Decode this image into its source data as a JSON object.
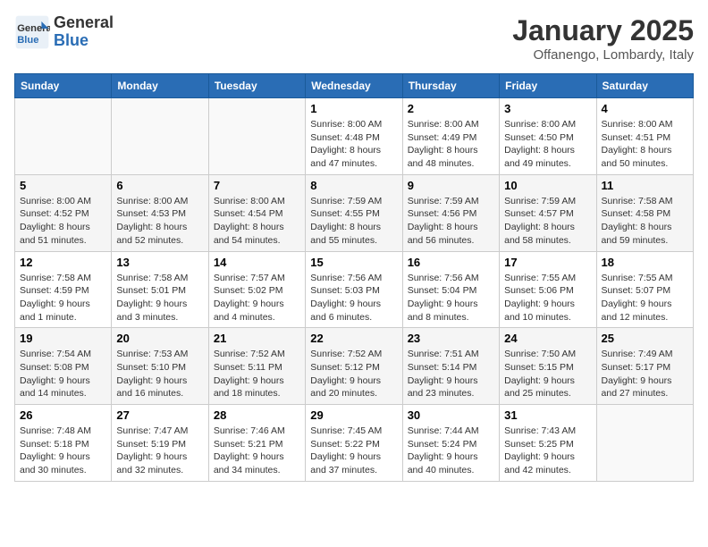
{
  "logo": {
    "line1": "General",
    "line2": "Blue"
  },
  "title": "January 2025",
  "location": "Offanengo, Lombardy, Italy",
  "weekdays": [
    "Sunday",
    "Monday",
    "Tuesday",
    "Wednesday",
    "Thursday",
    "Friday",
    "Saturday"
  ],
  "weeks": [
    [
      {
        "day": "",
        "info": ""
      },
      {
        "day": "",
        "info": ""
      },
      {
        "day": "",
        "info": ""
      },
      {
        "day": "1",
        "info": "Sunrise: 8:00 AM\nSunset: 4:48 PM\nDaylight: 8 hours and 47 minutes."
      },
      {
        "day": "2",
        "info": "Sunrise: 8:00 AM\nSunset: 4:49 PM\nDaylight: 8 hours and 48 minutes."
      },
      {
        "day": "3",
        "info": "Sunrise: 8:00 AM\nSunset: 4:50 PM\nDaylight: 8 hours and 49 minutes."
      },
      {
        "day": "4",
        "info": "Sunrise: 8:00 AM\nSunset: 4:51 PM\nDaylight: 8 hours and 50 minutes."
      }
    ],
    [
      {
        "day": "5",
        "info": "Sunrise: 8:00 AM\nSunset: 4:52 PM\nDaylight: 8 hours and 51 minutes."
      },
      {
        "day": "6",
        "info": "Sunrise: 8:00 AM\nSunset: 4:53 PM\nDaylight: 8 hours and 52 minutes."
      },
      {
        "day": "7",
        "info": "Sunrise: 8:00 AM\nSunset: 4:54 PM\nDaylight: 8 hours and 54 minutes."
      },
      {
        "day": "8",
        "info": "Sunrise: 7:59 AM\nSunset: 4:55 PM\nDaylight: 8 hours and 55 minutes."
      },
      {
        "day": "9",
        "info": "Sunrise: 7:59 AM\nSunset: 4:56 PM\nDaylight: 8 hours and 56 minutes."
      },
      {
        "day": "10",
        "info": "Sunrise: 7:59 AM\nSunset: 4:57 PM\nDaylight: 8 hours and 58 minutes."
      },
      {
        "day": "11",
        "info": "Sunrise: 7:58 AM\nSunset: 4:58 PM\nDaylight: 8 hours and 59 minutes."
      }
    ],
    [
      {
        "day": "12",
        "info": "Sunrise: 7:58 AM\nSunset: 4:59 PM\nDaylight: 9 hours and 1 minute."
      },
      {
        "day": "13",
        "info": "Sunrise: 7:58 AM\nSunset: 5:01 PM\nDaylight: 9 hours and 3 minutes."
      },
      {
        "day": "14",
        "info": "Sunrise: 7:57 AM\nSunset: 5:02 PM\nDaylight: 9 hours and 4 minutes."
      },
      {
        "day": "15",
        "info": "Sunrise: 7:56 AM\nSunset: 5:03 PM\nDaylight: 9 hours and 6 minutes."
      },
      {
        "day": "16",
        "info": "Sunrise: 7:56 AM\nSunset: 5:04 PM\nDaylight: 9 hours and 8 minutes."
      },
      {
        "day": "17",
        "info": "Sunrise: 7:55 AM\nSunset: 5:06 PM\nDaylight: 9 hours and 10 minutes."
      },
      {
        "day": "18",
        "info": "Sunrise: 7:55 AM\nSunset: 5:07 PM\nDaylight: 9 hours and 12 minutes."
      }
    ],
    [
      {
        "day": "19",
        "info": "Sunrise: 7:54 AM\nSunset: 5:08 PM\nDaylight: 9 hours and 14 minutes."
      },
      {
        "day": "20",
        "info": "Sunrise: 7:53 AM\nSunset: 5:10 PM\nDaylight: 9 hours and 16 minutes."
      },
      {
        "day": "21",
        "info": "Sunrise: 7:52 AM\nSunset: 5:11 PM\nDaylight: 9 hours and 18 minutes."
      },
      {
        "day": "22",
        "info": "Sunrise: 7:52 AM\nSunset: 5:12 PM\nDaylight: 9 hours and 20 minutes."
      },
      {
        "day": "23",
        "info": "Sunrise: 7:51 AM\nSunset: 5:14 PM\nDaylight: 9 hours and 23 minutes."
      },
      {
        "day": "24",
        "info": "Sunrise: 7:50 AM\nSunset: 5:15 PM\nDaylight: 9 hours and 25 minutes."
      },
      {
        "day": "25",
        "info": "Sunrise: 7:49 AM\nSunset: 5:17 PM\nDaylight: 9 hours and 27 minutes."
      }
    ],
    [
      {
        "day": "26",
        "info": "Sunrise: 7:48 AM\nSunset: 5:18 PM\nDaylight: 9 hours and 30 minutes."
      },
      {
        "day": "27",
        "info": "Sunrise: 7:47 AM\nSunset: 5:19 PM\nDaylight: 9 hours and 32 minutes."
      },
      {
        "day": "28",
        "info": "Sunrise: 7:46 AM\nSunset: 5:21 PM\nDaylight: 9 hours and 34 minutes."
      },
      {
        "day": "29",
        "info": "Sunrise: 7:45 AM\nSunset: 5:22 PM\nDaylight: 9 hours and 37 minutes."
      },
      {
        "day": "30",
        "info": "Sunrise: 7:44 AM\nSunset: 5:24 PM\nDaylight: 9 hours and 40 minutes."
      },
      {
        "day": "31",
        "info": "Sunrise: 7:43 AM\nSunset: 5:25 PM\nDaylight: 9 hours and 42 minutes."
      },
      {
        "day": "",
        "info": ""
      }
    ]
  ]
}
